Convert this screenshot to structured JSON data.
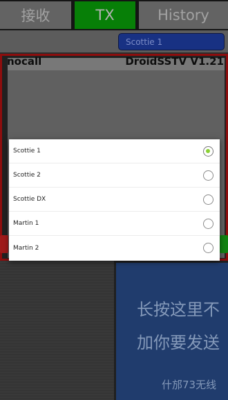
{
  "tabs": [
    {
      "label": "接收"
    },
    {
      "label": "TX"
    },
    {
      "label": "History"
    }
  ],
  "mode_button": {
    "label": "Scottie 1"
  },
  "image": {
    "callsign": "nocall",
    "app_name": "DroidSSTV V1.21"
  },
  "hint": {
    "line1": "长按这里不",
    "line2": "加你要发送",
    "footer": "什邡73无线"
  },
  "dialog": {
    "options": [
      {
        "label": "Scottie 1",
        "selected": true
      },
      {
        "label": "Scottie 2",
        "selected": false
      },
      {
        "label": "Scottie DX",
        "selected": false
      },
      {
        "label": "Martin 1",
        "selected": false
      },
      {
        "label": "Martin 2",
        "selected": false
      }
    ]
  },
  "colors": {
    "active_tab": "#0aa30a",
    "mode_button": "#1f3fa8",
    "frame_border": "#b51212",
    "hint_panel": "#2a4d8c",
    "radio_selected": "#8bd134"
  }
}
